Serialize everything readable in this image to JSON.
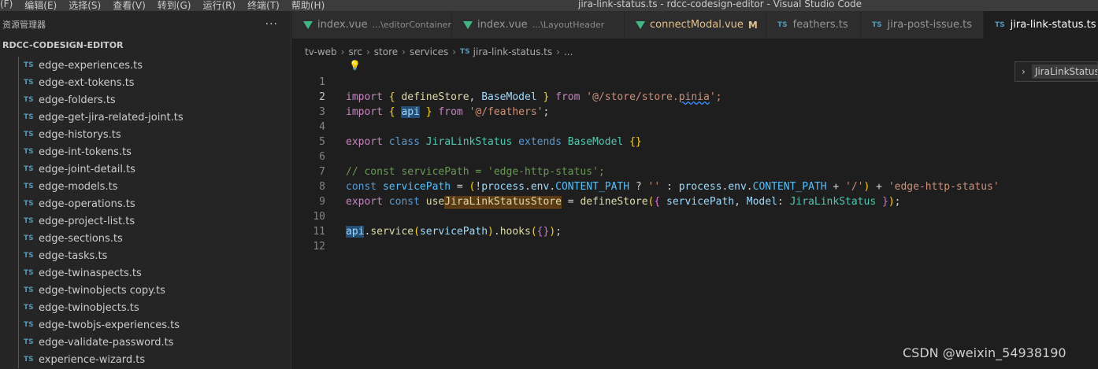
{
  "window": {
    "menu": [
      "(F)",
      "编辑(E)",
      "选择(S)",
      "查看(V)",
      "转到(G)",
      "运行(R)",
      "终端(T)",
      "帮助(H)"
    ],
    "title": "jira-link-status.ts - rdcc-codesign-editor - Visual Studio Code"
  },
  "sidebar": {
    "title": "资源管理器",
    "more": "···",
    "section": "RDCC-CODESIGN-EDITOR",
    "file_icon": "TS",
    "files": [
      "edge-experiences.ts",
      "edge-ext-tokens.ts",
      "edge-folders.ts",
      "edge-get-jira-related-joint.ts",
      "edge-historys.ts",
      "edge-int-tokens.ts",
      "edge-joint-detail.ts",
      "edge-models.ts",
      "edge-operations.ts",
      "edge-project-list.ts",
      "edge-sections.ts",
      "edge-tasks.ts",
      "edge-twinaspects.ts",
      "edge-twinobjects copy.ts",
      "edge-twinobjects.ts",
      "edge-twobjs-experiences.ts",
      "edge-validate-password.ts",
      "experience-wizard.ts"
    ]
  },
  "tabs": [
    {
      "label": "index.vue",
      "desc": "...\\editorContainer",
      "icon": "vue-icon"
    },
    {
      "label": "index.vue",
      "desc": "...\\LayoutHeader",
      "icon": "vue-icon"
    },
    {
      "label": "connectModal.vue",
      "mod": "M",
      "icon": "vue-icon"
    },
    {
      "label": "feathers.ts",
      "icon": "TS"
    },
    {
      "label": "jira-post-issue.ts",
      "icon": "TS"
    },
    {
      "label": "jira-link-status.ts",
      "icon": "TS",
      "close": "✕"
    }
  ],
  "breadcrumb": {
    "parts": [
      "tv-web",
      "src",
      "store",
      "services"
    ],
    "file_icon": "TS",
    "file": "jira-link-status.ts",
    "more": "..."
  },
  "editor": {
    "line_numbers": [
      "1",
      "2",
      "3",
      "4",
      "5",
      "6",
      "7",
      "8",
      "9",
      "10",
      "11",
      "12"
    ],
    "tokens": {
      "import": "import",
      "lbrace": "{",
      "rbrace": "}",
      "defineStore": "defineStore",
      "comma": ",",
      "BaseModel": "BaseModel",
      "from": "from",
      "store_path": "'@/store/store.",
      "pinia": "pinia",
      "quote_semi": "';",
      "api": "api",
      "feathers_path": "'@/feathers'",
      "semi": ";",
      "export": "export",
      "class": "class",
      "JiraLinkStatus": "JiraLinkStatus",
      "extends": "extends",
      "empty_braces": "{}",
      "comment": "// const servicePath = 'edge-http-status';",
      "const": "const",
      "servicePath": "servicePath",
      "eq": "=",
      "lparen": "(",
      "bang": "!",
      "process": "process",
      "dot": ".",
      "env": "env",
      "CONTENT_PATH": "CONTENT_PATH",
      "q": "?",
      "empty_str": "''",
      "colon": ":",
      "plus": "+",
      "slash_str": "'/'",
      "rparen": ")",
      "http_status": "'edge-http-status'",
      "use": "use",
      "JiraLinkStatusStore": "JiraLinkStatusStore",
      "Model": "Model",
      "service": "service",
      "hooks": "hooks"
    }
  },
  "outline": {
    "chevron": "›",
    "label": "JiraLinkStatus"
  },
  "watermark": "CSDN @weixin_54938190",
  "colors": {
    "accent": "#007acc",
    "background": "#1e1e1e",
    "sidebar": "#252526"
  }
}
